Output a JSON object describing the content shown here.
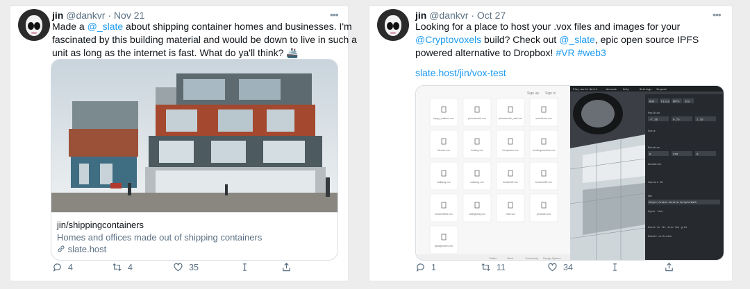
{
  "tweet1": {
    "name": "jin",
    "handle": "@dankvr",
    "date": "Nov 21",
    "more": "•••",
    "text": {
      "l1_pre": "Made a ",
      "l1_link": "@_slate",
      "l1_post": " about shipping container homes and businesses. I'm",
      "l2": "fascinated by this building material and would be down to live in such a",
      "l3": "unit as long as the internet is fast. What do ya'll think? 🚢"
    },
    "card": {
      "title": "jin/shippingcontainers",
      "description": "Homes and offices made out of shipping containers",
      "domain": "slate.host"
    },
    "actions": {
      "replies": "4",
      "retweets": "4",
      "likes": "35"
    }
  },
  "tweet2": {
    "name": "jin",
    "handle": "@dankvr",
    "date": "Oct 27",
    "more": "•••",
    "text": {
      "l1": "Looking for a place to host your .vox files and images for your",
      "l2_link1": "@Cryptovoxels",
      "l2_mid": " build? Check out ",
      "l2_link2": "@_slate",
      "l2_post": ", epic open source IPFS",
      "l3_pre": "powered alternative to Dropbox! ",
      "l3_tag1": "#VR",
      "l3_tag2": "#web3",
      "link": "slate.host/jin/vox-test"
    },
    "screenshot": {
      "nav": [
        "Sign up",
        "Sign in"
      ],
      "files": [
        "trippy_walkers.vox",
        "phonebooth.vox",
        "phonebooth_wall.vox",
        "sushiclone.vox",
        "filecoin.vox",
        "hotdog.vox",
        "hexapawn.vox",
        "vendingmachine.vox",
        "walkdog.vox",
        "walkdog.vox",
        "bookshelf.vox",
        "bookshelf3.vox",
        "bookshelf4k.vox",
        "catbigbang.vox",
        "chair.vox",
        "jonathan.vox",
        "garageraisin.vox"
      ],
      "footer": [
        "Twitter",
        "Slack",
        "Community",
        "Design System"
      ],
      "editor_tabs": [
        "Add",
        "Files",
        "NFTs",
        "Ins"
      ],
      "panel_labels": [
        "Position",
        "Scale",
        "Rotation",
        "Animation",
        "Capture ID",
        "URL",
        "Hyper link",
        "Scale to fit into the grid",
        "Enable collision"
      ],
      "panel_url": "https://slate.textile.io/ipfs/bafk",
      "editor_nav": [
        "Play world",
        "World",
        "Account",
        "Help",
        "Settings",
        "Inspect"
      ],
      "values_pos": [
        "-7.25",
        "0.75",
        "1.25"
      ],
      "values_rot": [
        "0",
        "270",
        "0"
      ]
    },
    "actions": {
      "replies": "1",
      "retweets": "11",
      "likes": "34"
    }
  },
  "colors": {
    "accent": "#1d9bf0",
    "muted": "#5b7083",
    "text": "#0f1419"
  },
  "icons": [
    "reply-icon",
    "retweet-icon",
    "like-icon",
    "analytics-icon",
    "share-icon",
    "link-icon",
    "more-icon"
  ]
}
